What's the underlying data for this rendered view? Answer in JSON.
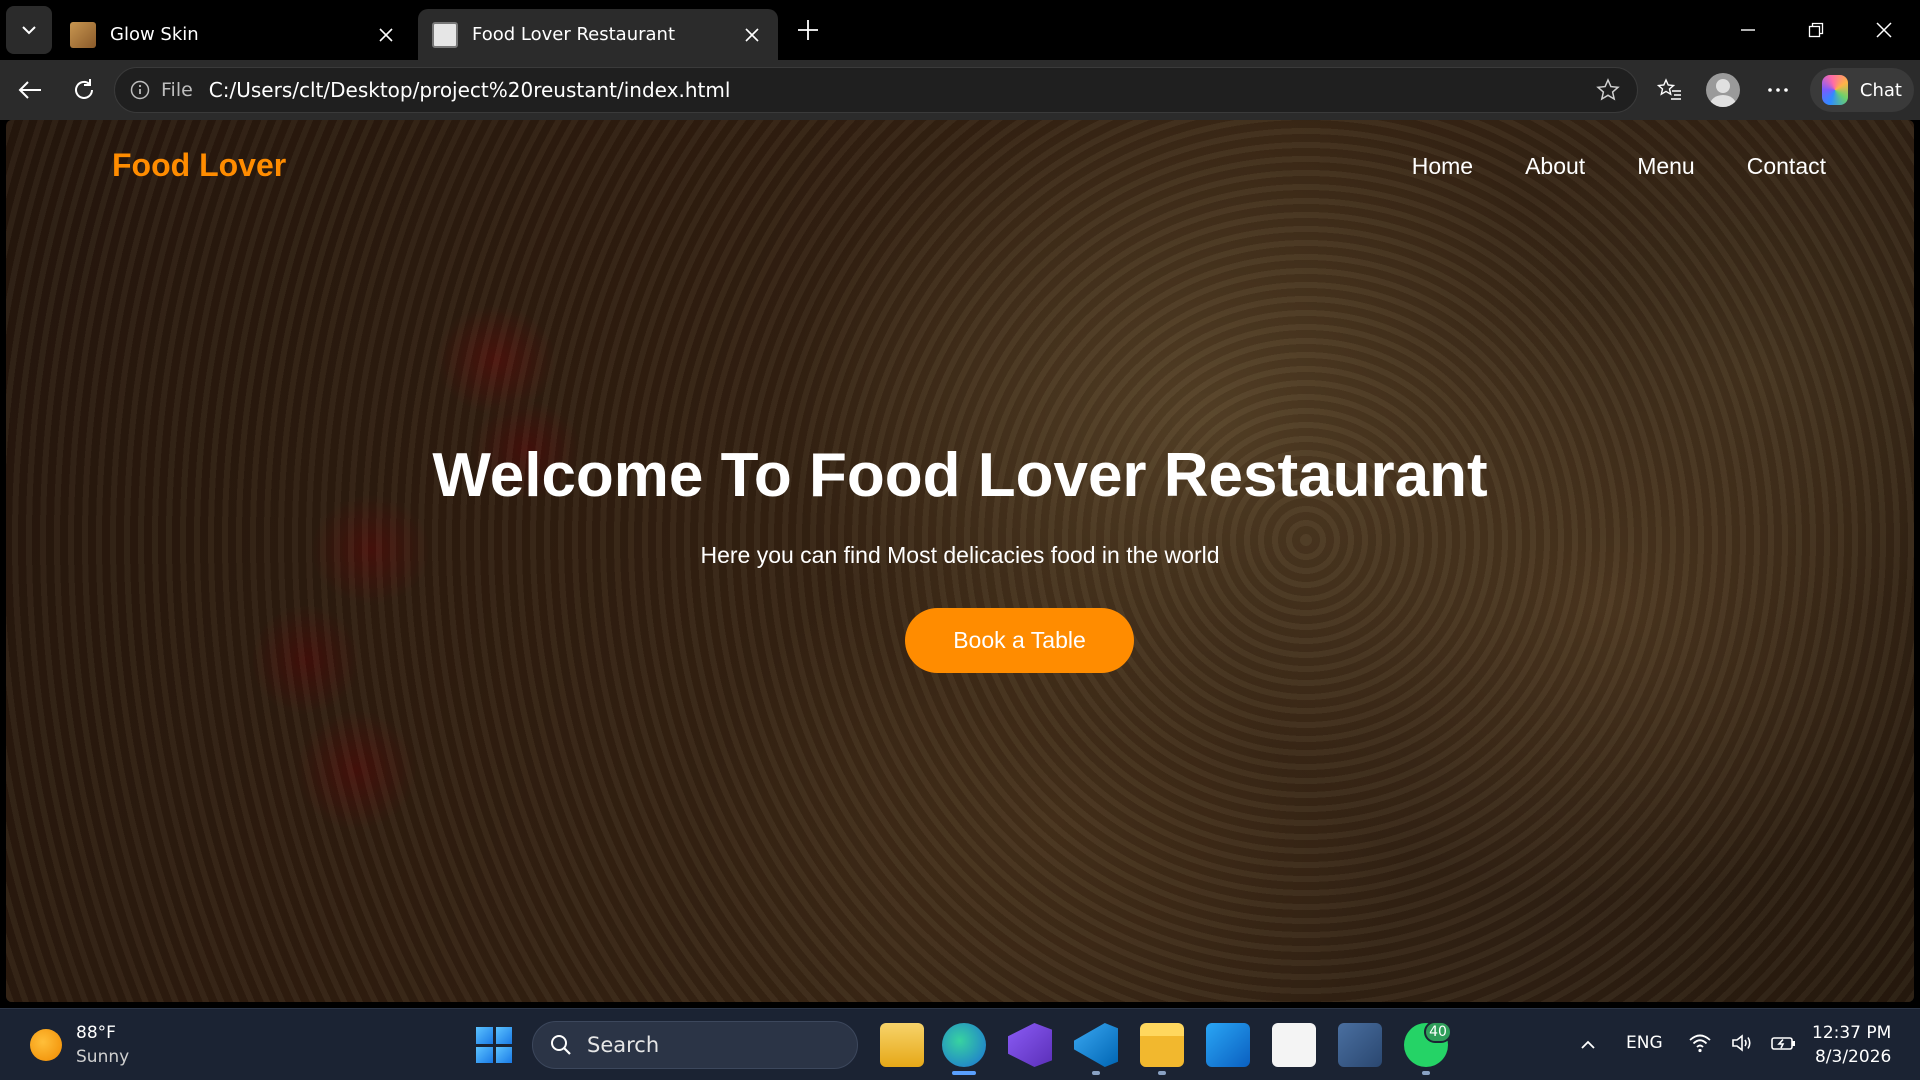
{
  "browser": {
    "tabs": [
      {
        "title": "Glow Skin",
        "active": false
      },
      {
        "title": "Food Lover Restaurant",
        "active": true
      }
    ],
    "address": {
      "scheme_label": "File",
      "url": "C:/Users/clt/Desktop/project%20reustant/index.html"
    },
    "chat_label": "Chat"
  },
  "page": {
    "logo": "Food Lover",
    "nav": [
      "Home",
      "About",
      "Menu",
      "Contact"
    ],
    "hero": {
      "title": "Welcome To Food Lover Restaurant",
      "subtitle": "Here you can find Most delicacies food in the world",
      "cta": "Book a Table"
    },
    "colors": {
      "accent": "#ff8c00",
      "text": "#ffffff"
    }
  },
  "taskbar": {
    "weather": {
      "temp": "88°F",
      "condition": "Sunny"
    },
    "search_label": "Search",
    "whatsapp_badge": "40",
    "language": "ENG",
    "time": "12:37 PM",
    "date": "8/3/2026"
  }
}
